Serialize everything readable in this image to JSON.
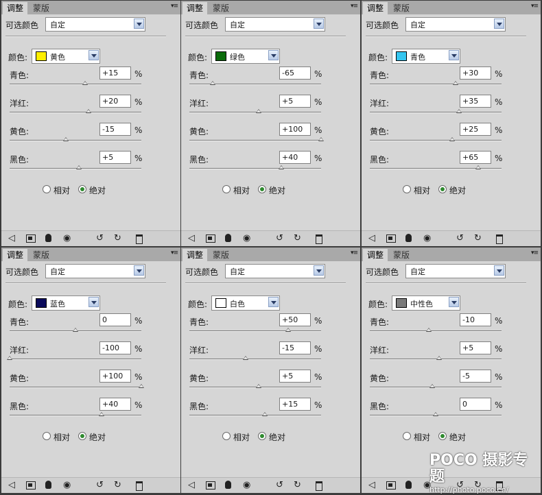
{
  "common": {
    "tab_active": "调整",
    "tab_inactive": "蒙版",
    "panel_menu": "▾≡",
    "preset_label": "可选颜色",
    "preset_value": "自定",
    "color_label": "颜色:",
    "slider_labels": [
      "青色:",
      "洋红:",
      "黄色:",
      "黑色:"
    ],
    "pct": "%",
    "radio_relative": "相对",
    "radio_absolute": "绝对",
    "selected_mode": "绝对"
  },
  "panels": [
    {
      "color_name": "黄色",
      "swatch": "#ffef00",
      "values": [
        "+15",
        "+20",
        "-15",
        "+5"
      ],
      "levels": [
        15,
        20,
        -15,
        5
      ]
    },
    {
      "color_name": "绿色",
      "swatch": "#0a6b0a",
      "values": [
        "-65",
        "+5",
        "+100",
        "+40"
      ],
      "levels": [
        -65,
        5,
        100,
        40
      ]
    },
    {
      "color_name": "青色",
      "swatch": "#35c6f0",
      "values": [
        "+30",
        "+35",
        "+25",
        "+65"
      ],
      "levels": [
        30,
        35,
        25,
        65
      ]
    },
    {
      "color_name": "蓝色",
      "swatch": "#0a0a5a",
      "values": [
        "0",
        "-100",
        "+100",
        "+40"
      ],
      "levels": [
        0,
        -100,
        100,
        40
      ]
    },
    {
      "color_name": "白色",
      "swatch": "#ffffff",
      "values": [
        "+50",
        "-15",
        "+5",
        "+15"
      ],
      "levels": [
        50,
        -15,
        5,
        15
      ]
    },
    {
      "color_name": "中性色",
      "swatch": "#7a7a7a",
      "values": [
        "-10",
        "+5",
        "-5",
        "0"
      ],
      "levels": [
        -10,
        5,
        -5,
        0
      ]
    }
  ],
  "watermark": {
    "logo": "POCO 摄影专题",
    "url": "http://photo.poco.cn/"
  }
}
